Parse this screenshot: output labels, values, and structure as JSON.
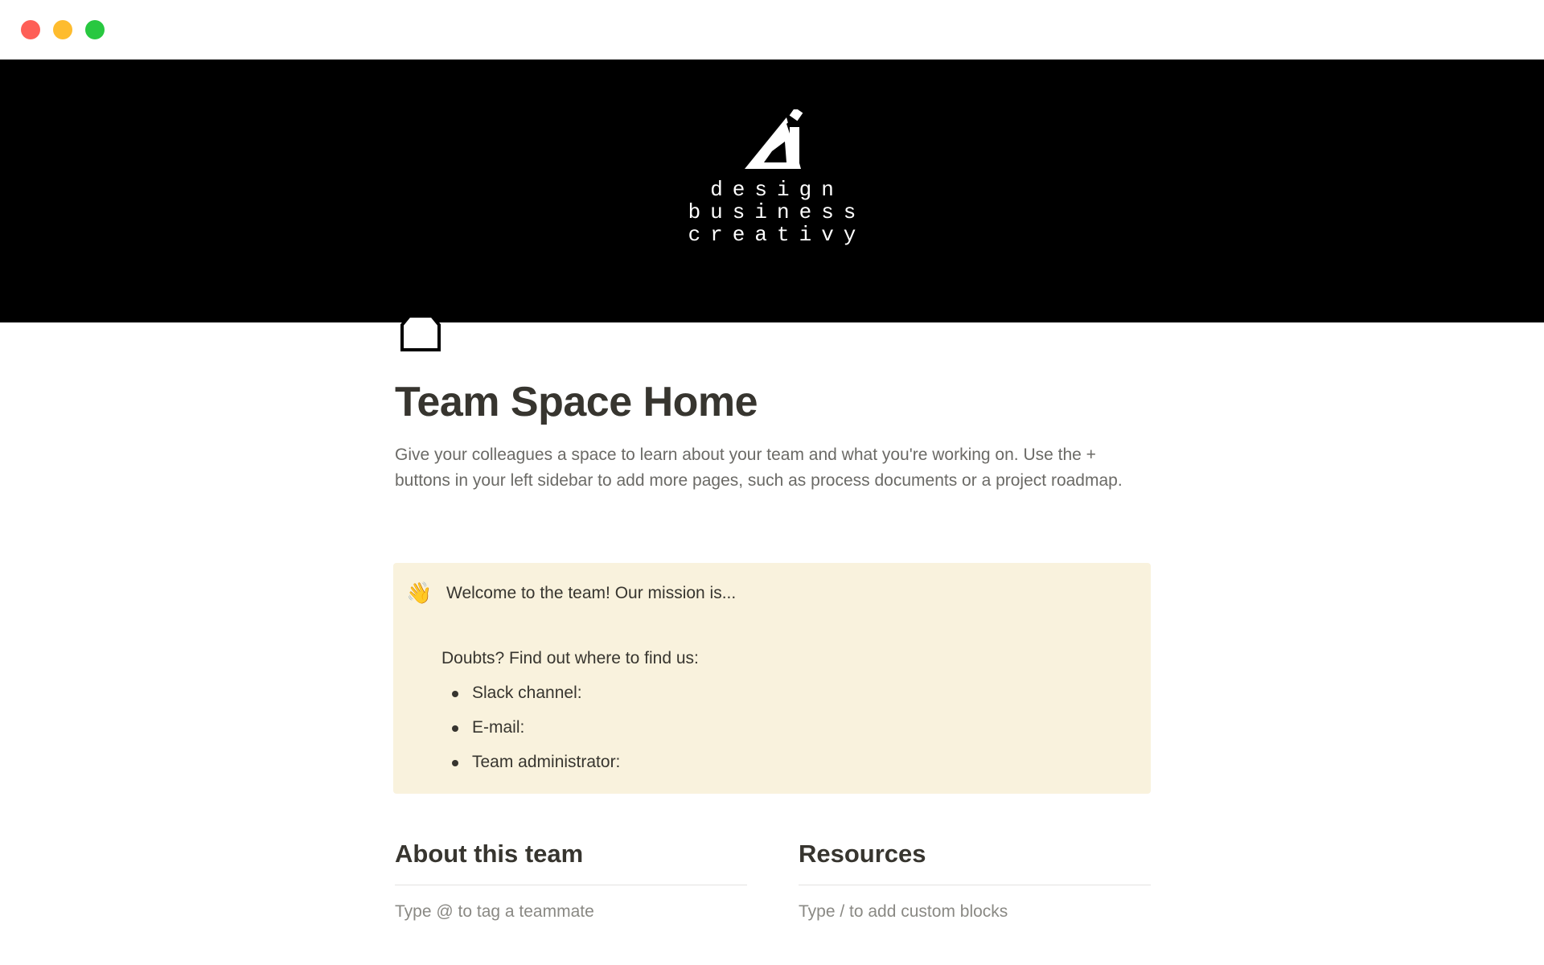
{
  "window": {
    "controls": [
      "close",
      "minimize",
      "zoom"
    ]
  },
  "cover": {
    "logo_icon": "triangle-ruler-logo",
    "lines": [
      "design",
      "business",
      "creativy"
    ]
  },
  "page": {
    "icon": "home-icon",
    "title": "Team Space Home",
    "description": "Give your colleagues a space to learn about your team and what you're working on. Use the + buttons in your left sidebar to add more pages, such as process documents or a project roadmap."
  },
  "callout": {
    "emoji": "👋",
    "title": "Welcome to the team! Our mission is...",
    "subheading": "Doubts? Find out where to find us:",
    "items": [
      "Slack channel:",
      "E-mail:",
      "Team administrator:"
    ],
    "background": "#f9f2dd"
  },
  "columns": [
    {
      "heading": "About this team",
      "placeholder": "Type @ to tag a teammate"
    },
    {
      "heading": "Resources",
      "placeholder": "Type / to add custom blocks"
    }
  ],
  "colors": {
    "text": "#37352f",
    "muted": "#6b6a66",
    "close": "#fe5f57",
    "minimize": "#febc2e",
    "zoom": "#28c840"
  }
}
